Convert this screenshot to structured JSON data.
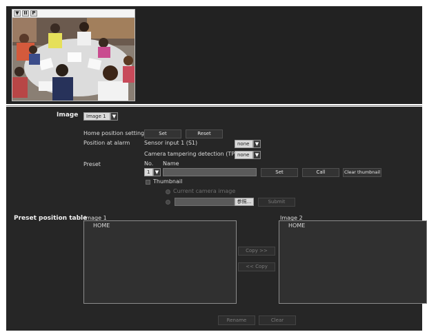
{
  "viewer": {
    "controls": [
      "▼",
      "II",
      "P"
    ],
    "camera_alt": "children drawing at table"
  },
  "image_select": {
    "label": "Image",
    "value": "Image 1"
  },
  "home_position": {
    "label": "Home position setting",
    "set_label": "Set",
    "reset_label": "Reset"
  },
  "alarm": {
    "label": "Position at alarm",
    "sensor_label": "Sensor input 1 (S1)",
    "sensor_value": "none",
    "tamper_label": "Camera tampering detection (TP)",
    "tamper_value": "none"
  },
  "preset": {
    "label": "Preset",
    "no_header": "No.",
    "name_header": "Name",
    "no_value": "1",
    "name_value": "",
    "set_label": "Set",
    "call_label": "Call",
    "clear_thumb_label": "Clear thumbnail",
    "thumbnail_label": "Thumbnail",
    "current_camera_label": "Current camera image",
    "browse_label": "参照...",
    "submit_label": "Submit"
  },
  "table": {
    "label": "Preset position table",
    "image1_label": "Image 1",
    "image2_label": "Image 2",
    "image1_items": [
      "HOME"
    ],
    "image2_items": [
      "HOME"
    ],
    "copy_right_label": "Copy >>",
    "copy_left_label": "<< Copy",
    "rename_label": "Rename",
    "clear_label": "Clear"
  }
}
